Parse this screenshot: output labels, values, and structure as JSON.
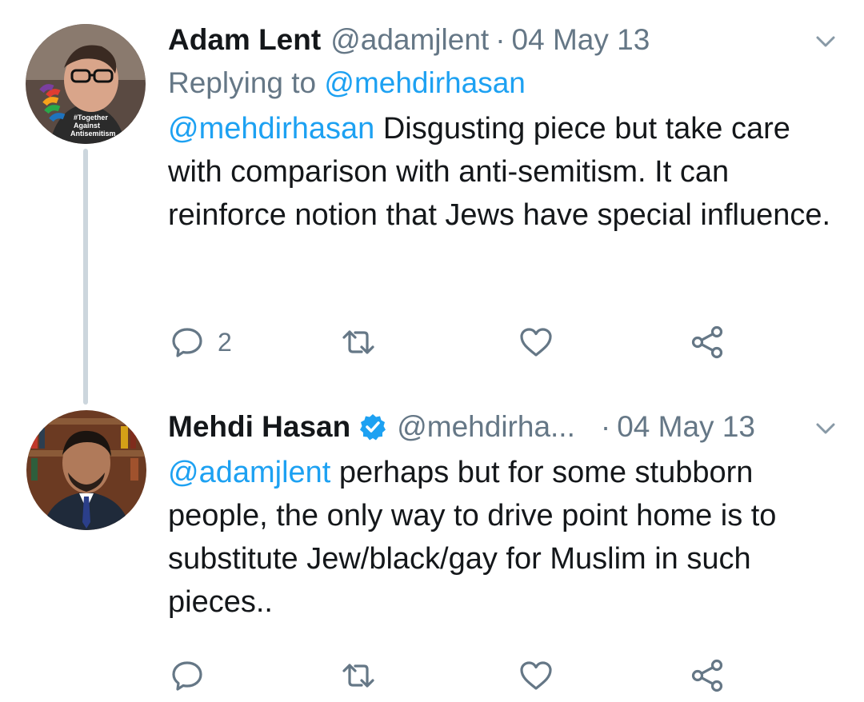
{
  "tweets": [
    {
      "name": "Adam Lent",
      "handle": "@adamjlent",
      "separator": "·",
      "date": "04 May 13",
      "replying_prefix": "Replying to ",
      "replying_to": "@mehdirhasan",
      "mention": "@mehdirhasan",
      "text": " Disgusting piece but take care with comparison with anti-semitism. It can reinforce notion that Jews have special influence.",
      "reply_count": "2",
      "avatar_badge_text": "#Together Against Antisemitism"
    },
    {
      "name": "Mehdi Hasan",
      "verified": true,
      "handle": "@mehdirha...",
      "separator": "·",
      "date": "04 May 13",
      "mention": "@adamjlent",
      "text": " perhaps but for some stubborn people, the only way to drive point home is to substitute Jew/black/gay for Muslim in such pieces.."
    }
  ],
  "icons": {
    "reply": "reply-icon",
    "retweet": "retweet-icon",
    "like": "heart-icon",
    "share": "share-icon",
    "menu": "chevron-down-icon",
    "verified": "verified-badge-icon"
  },
  "colors": {
    "link": "#1da1f2",
    "secondary_text": "#657786",
    "thread_line": "#ccd6dd",
    "verified": "#1da1f2"
  }
}
